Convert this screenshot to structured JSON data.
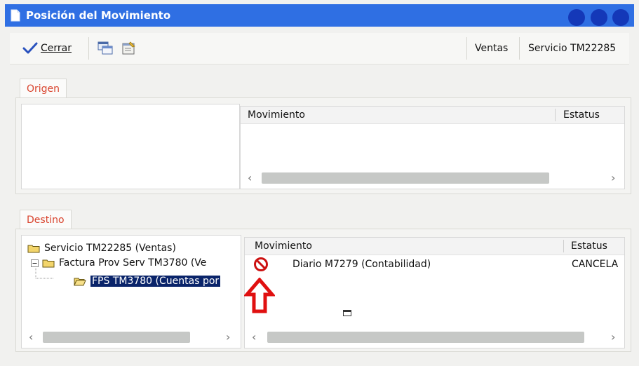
{
  "window": {
    "title": "Posición del Movimiento"
  },
  "toolbar": {
    "close_label": "Cerrar",
    "module": "Ventas",
    "reference": "Servicio TM22285"
  },
  "origin": {
    "tab_label": "Origen",
    "columns": {
      "movement": "Movimiento",
      "status": "Estatus"
    }
  },
  "destination": {
    "tab_label": "Destino",
    "tree": [
      "Servicio TM22285 (Ventas)",
      "Factura Prov Serv TM3780 (Ve",
      "FPS TM3780 (Cuentas por"
    ],
    "columns": {
      "movement": "Movimiento",
      "status": "Estatus"
    },
    "rows": [
      {
        "movement": "Diario M7279 (Contabilidad)",
        "status": "CANCELA"
      }
    ]
  },
  "colors": {
    "titlebar": "#2f6fe3",
    "accent_text": "#d9452f",
    "selection": "#0a246a",
    "cancel_icon": "#cc1111"
  }
}
